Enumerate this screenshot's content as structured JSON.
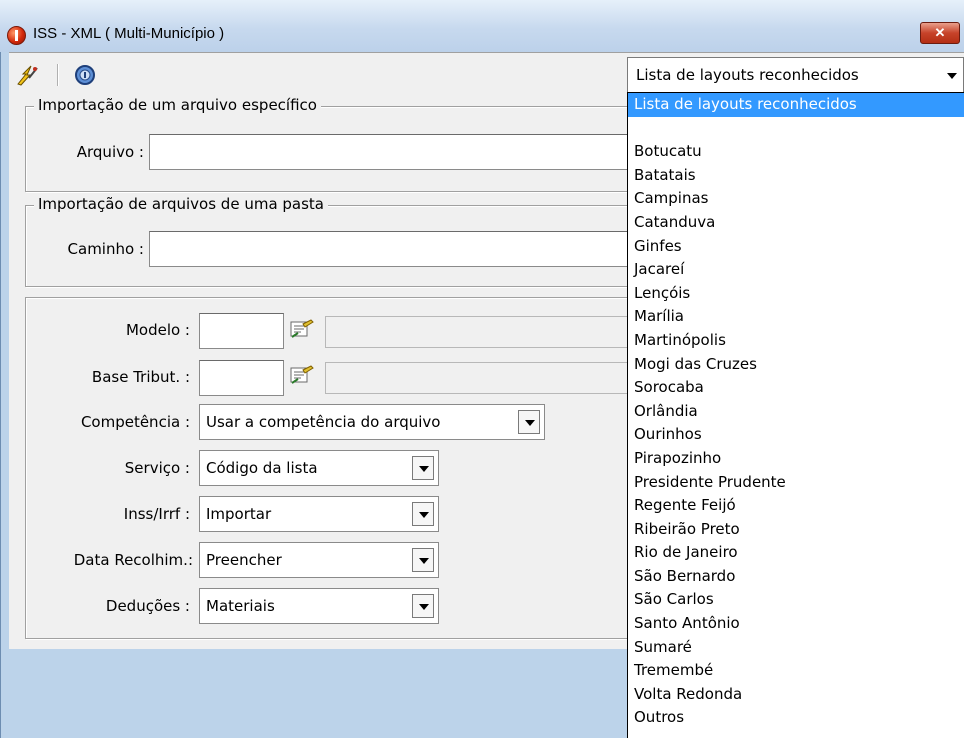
{
  "window": {
    "title": "ISS - XML ( Multi-Município )",
    "close_label": "✕"
  },
  "toolbar": {
    "buttons": [
      {
        "icon": "lightning-wand-icon"
      },
      {
        "icon": "info-icon"
      }
    ]
  },
  "layout_select": {
    "value": "Lista de layouts reconhecidos",
    "options": [
      "Lista de layouts reconhecidos",
      "",
      "Botucatu",
      "Batatais",
      "Campinas",
      "Catanduva",
      "Ginfes",
      "Jacareí",
      "Lençóis",
      "Marília",
      "Martinópolis",
      "Mogi das Cruzes",
      "Sorocaba",
      "Orlândia",
      "Ourinhos",
      "Pirapozinho",
      "Presidente Prudente",
      "Regente Feijó",
      "Ribeirão Preto",
      "Rio de Janeiro",
      "São Bernardo",
      "São Carlos",
      "Santo Antônio",
      "Sumaré",
      "Tremembé",
      "Volta Redonda",
      "Outros"
    ],
    "selected_index": 0
  },
  "file_group": {
    "legend": "Importação de um arquivo específico",
    "label": "Arquivo :",
    "value": ""
  },
  "folder_group": {
    "legend": "Importação de arquivos de uma pasta",
    "label": "Caminho :",
    "value": ""
  },
  "params": {
    "modelo_label": "Modelo :",
    "modelo_value": "",
    "base_label": "Base Tribut. :",
    "base_value": "",
    "competencia_label": "Competência :",
    "competencia_value": "Usar a competência do arquivo",
    "servico_label": "Serviço :",
    "servico_value": "Código da lista",
    "inss_label": "Inss/Irrf :",
    "inss_value": "Importar",
    "data_label": "Data Recolhim.:",
    "data_value": "Preencher",
    "deducoes_label": "Deduções :",
    "deducoes_value": "Materiais"
  },
  "colors": {
    "selection": "#3399ff",
    "titlebar": "#c7d9ee",
    "close": "#c7432a"
  }
}
